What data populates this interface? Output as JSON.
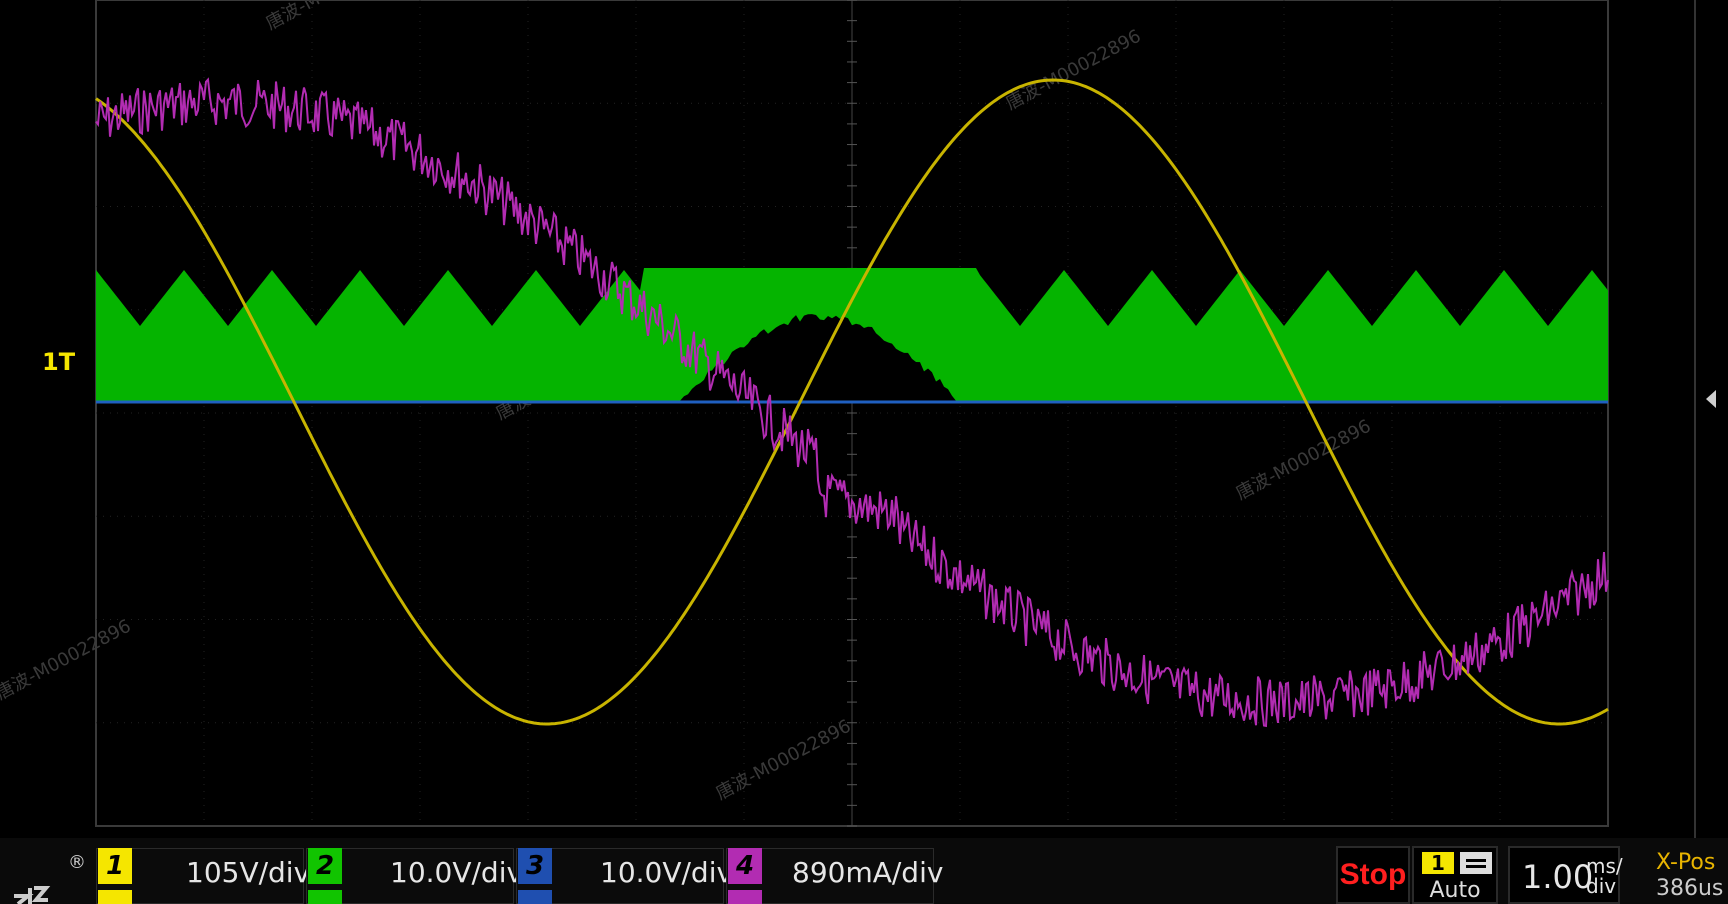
{
  "channels": [
    {
      "num": "1",
      "scale": "105V/div",
      "color": "#f5e600"
    },
    {
      "num": "2",
      "scale": "10.0V/div",
      "color": "#11c400"
    },
    {
      "num": "3",
      "scale": "10.0V/div",
      "color": "#1f4fb0"
    },
    {
      "num": "4",
      "scale": "890mA/div",
      "color": "#b22cb2"
    }
  ],
  "status": "Stop",
  "trigger": {
    "source": "1",
    "mode": "Auto",
    "marker": "1T"
  },
  "timebase": {
    "value": "1.00",
    "unit_top": "ms/",
    "unit_bottom": "div"
  },
  "xpos": {
    "label": "X-Pos",
    "value": "386us"
  },
  "watermark": "唐波-M00022896",
  "icons": {
    "logo": "zlg-logo",
    "side": "chevron-left-icon",
    "trigger_mode": "menu-icon"
  }
}
